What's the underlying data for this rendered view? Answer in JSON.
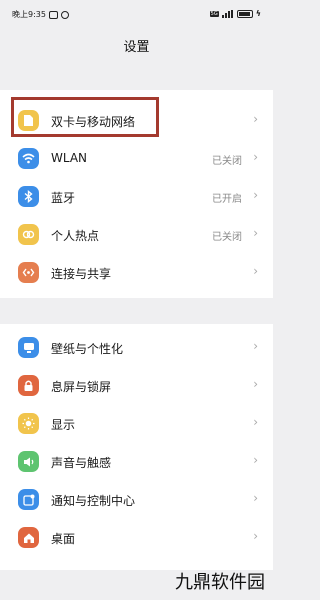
{
  "status_bar": {
    "time": "晚上9:35",
    "net_tag": "5G"
  },
  "page_title": "设置",
  "groups": [
    {
      "items": [
        {
          "label": "双卡与移动网络",
          "status": "",
          "icon": "sim-card-icon",
          "icon_color": "#f1c44c"
        },
        {
          "label": "WLAN",
          "status": "已关闭",
          "icon": "wifi-icon",
          "icon_color": "#3c8ee8"
        },
        {
          "label": "蓝牙",
          "status": "已开启",
          "icon": "bluetooth-icon",
          "icon_color": "#3c8ee8"
        },
        {
          "label": "个人热点",
          "status": "已关闭",
          "icon": "hotspot-icon",
          "icon_color": "#f1c44c"
        },
        {
          "label": "连接与共享",
          "status": "",
          "icon": "connection-icon",
          "icon_color": "#e57e4f"
        }
      ]
    },
    {
      "items": [
        {
          "label": "壁纸与个性化",
          "status": "",
          "icon": "wallpaper-icon",
          "icon_color": "#3c8ee8"
        },
        {
          "label": "息屏与锁屏",
          "status": "",
          "icon": "lock-icon",
          "icon_color": "#e0663f"
        },
        {
          "label": "显示",
          "status": "",
          "icon": "brightness-icon",
          "icon_color": "#f1c44c"
        },
        {
          "label": "声音与触感",
          "status": "",
          "icon": "sound-icon",
          "icon_color": "#5ec470"
        },
        {
          "label": "通知与控制中心",
          "status": "",
          "icon": "notification-icon",
          "icon_color": "#3c8ee8"
        },
        {
          "label": "桌面",
          "status": "",
          "icon": "home-icon",
          "icon_color": "#e0663f"
        }
      ]
    }
  ],
  "chevron": "›",
  "watermark": "九鼎软件园"
}
